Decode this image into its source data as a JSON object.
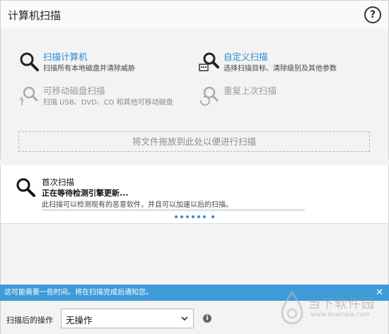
{
  "header": {
    "title": "计算机扫描",
    "help_icon": "help-icon"
  },
  "options": [
    {
      "name": "扫描计算机",
      "desc": "扫描所有本地磁盘并清除威胁",
      "icon": "magnifier-icon",
      "enabled": true
    },
    {
      "name": "自定义扫描",
      "desc": "选择扫描目标、清除级别及其他参数",
      "icon": "custom-scan-icon",
      "enabled": true
    },
    {
      "name": "可移动磁盘扫描",
      "desc": "扫描 USB、DVD、CD 和其他可移动磁盘",
      "icon": "removable-scan-icon",
      "enabled": false
    },
    {
      "name": "重复上次扫描",
      "desc": "",
      "icon": "repeat-scan-icon",
      "enabled": false
    }
  ],
  "dropzone": {
    "label": "将文件拖放到此处以便进行扫描"
  },
  "status": {
    "title": "首次扫描",
    "subtitle": "正在等待检测引擎更新...",
    "description": "此扫描可以检测现有的恶意软件，并且可以加速以后的扫描。"
  },
  "notification": {
    "message": "这可能需要一些时间。将在扫描完成后通知您。",
    "close_icon": "close-icon"
  },
  "footer": {
    "label": "扫描后的操作",
    "select_value": "无操作"
  },
  "watermark": {
    "text": "当下软件园",
    "sub": "www.downxia.com"
  },
  "colors": {
    "accent": "#2a8bd3",
    "notify_bg": "#3d9bd8",
    "background": "#f3f3f3"
  }
}
